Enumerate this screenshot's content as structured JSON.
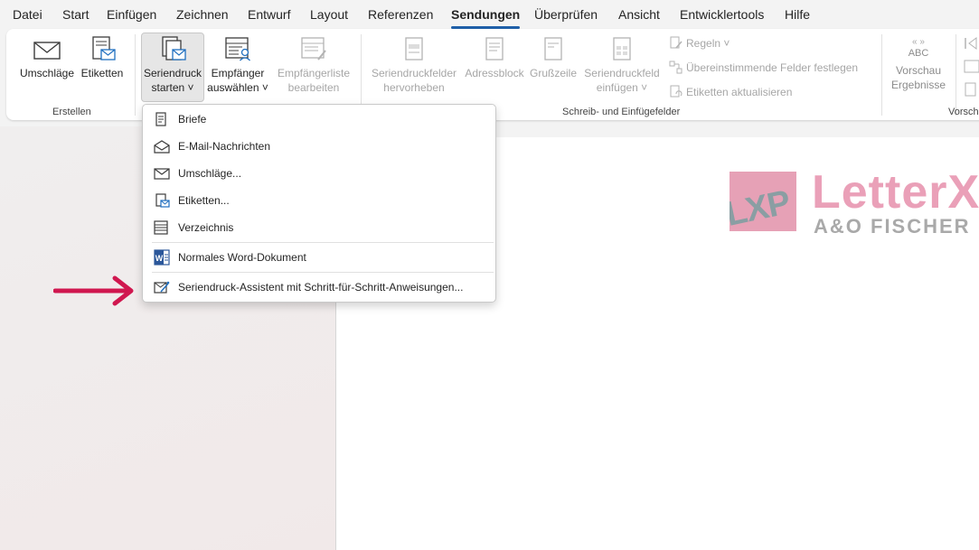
{
  "menu": {
    "tabs": [
      "Datei",
      "Start",
      "Einfügen",
      "Zeichnen",
      "Entwurf",
      "Layout",
      "Referenzen",
      "Sendungen",
      "Überprüfen",
      "Ansicht",
      "Entwicklertools",
      "Hilfe"
    ],
    "active": "Sendungen"
  },
  "ribbon": {
    "erstellen": {
      "label": "Erstellen",
      "umschlaege": "Umschläge",
      "etiketten": "Etiketten"
    },
    "start": {
      "seriendruck_line1": "Seriendruck",
      "seriendruck_line2": "starten ˅",
      "empfaenger_line1": "Empfänger",
      "empfaenger_line2": "auswählen ˅",
      "liste_line1": "Empfängerliste",
      "liste_line2": "bearbeiten"
    },
    "felder": {
      "label": "Schreib- und Einfügefelder",
      "hervorheben_line1": "Seriendruckfelder",
      "hervorheben_line2": "hervorheben",
      "adressblock": "Adressblock",
      "grusszeile": "Grußzeile",
      "einfuegen_line1": "Seriendruckfeld",
      "einfuegen_line2": "einfügen ˅",
      "regeln": "Regeln ˅",
      "uebereinstimmende": "Übereinstimmende Felder festlegen",
      "aktualisieren": "Etiketten aktualisieren"
    },
    "vorschau": {
      "label": "Vorscha",
      "abc": "ABC",
      "vorschau_line1": "Vorschau",
      "vorschau_line2": "Ergebnisse"
    }
  },
  "dropdown": {
    "items": [
      {
        "label": "Briefe",
        "icon": "letter-icon"
      },
      {
        "label": "E-Mail-Nachrichten",
        "icon": "email-open-icon"
      },
      {
        "label": "Umschläge...",
        "icon": "envelope-icon"
      },
      {
        "label": "Etiketten...",
        "icon": "label-icon"
      },
      {
        "label": "Verzeichnis",
        "icon": "directory-icon"
      },
      {
        "label": "Normales Word-Dokument",
        "icon": "word-document-icon"
      },
      {
        "label": "Seriendruck-Assistent mit Schritt-für-Schritt-Anweisungen...",
        "icon": "wizard-icon"
      }
    ]
  },
  "logo": {
    "box_text": "LXP",
    "title": "LetterX",
    "subtitle": "A&O FISCHER"
  },
  "colors": {
    "accent": "#1f5fa8",
    "arrow": "#d0174f",
    "logo_pink": "#eaa0b8",
    "logo_gray": "#a9a9a9"
  }
}
